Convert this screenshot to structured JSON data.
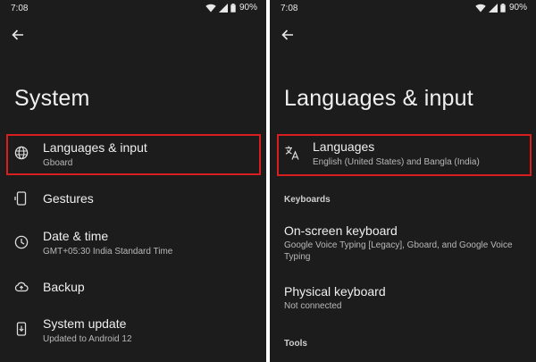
{
  "left": {
    "status": {
      "time": "7:08",
      "battery": "90%"
    },
    "title": "System",
    "items": [
      {
        "title": "Languages & input",
        "subtitle": "Gboard"
      },
      {
        "title": "Gestures",
        "subtitle": ""
      },
      {
        "title": "Date & time",
        "subtitle": "GMT+05:30 India Standard Time"
      },
      {
        "title": "Backup",
        "subtitle": ""
      },
      {
        "title": "System update",
        "subtitle": "Updated to Android 12"
      }
    ]
  },
  "right": {
    "status": {
      "time": "7:08",
      "battery": "90%"
    },
    "title": "Languages & input",
    "languages": {
      "title": "Languages",
      "subtitle": "English (United States) and Bangla (India)"
    },
    "sections": {
      "keyboards": "Keyboards",
      "tools": "Tools"
    },
    "keyboards": [
      {
        "title": "On-screen keyboard",
        "subtitle": "Google Voice Typing [Legacy], Gboard, and Google Voice Typing"
      },
      {
        "title": "Physical keyboard",
        "subtitle": "Not connected"
      }
    ]
  },
  "colors": {
    "background": "#1c1c1c",
    "highlight": "#d81e1e",
    "text": "#efefef",
    "subtext": "#b8b8b8"
  }
}
